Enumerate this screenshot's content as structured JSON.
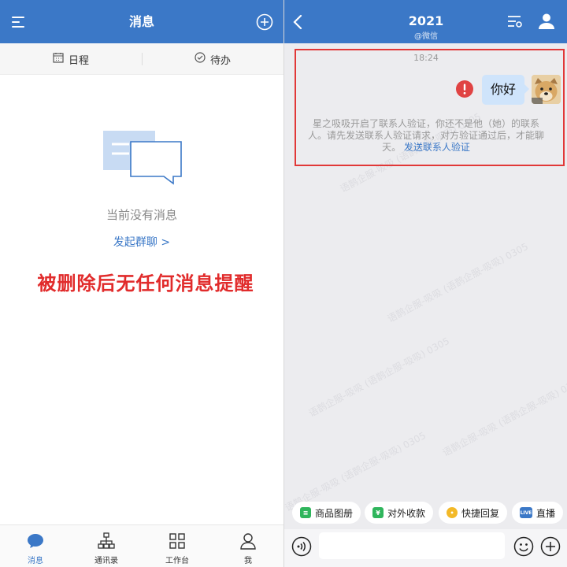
{
  "left": {
    "title": "消息",
    "icons": {
      "menu": "menu-icon",
      "add": "plus-circle-icon"
    },
    "subtabs": [
      {
        "label": "日程",
        "icon": "calendar-icon"
      },
      {
        "label": "待办",
        "icon": "check-circle-icon"
      }
    ],
    "empty_state": {
      "text": "当前没有消息",
      "link": "发起群聊 >"
    },
    "annotation": "被删除后无任何消息提醒",
    "tabbar": [
      {
        "label": "消息",
        "icon": "chat-bubble-icon",
        "active": true
      },
      {
        "label": "通讯录",
        "icon": "org-chart-icon",
        "active": false
      },
      {
        "label": "工作台",
        "icon": "grid-icon",
        "active": false
      },
      {
        "label": "我",
        "icon": "person-icon",
        "active": false
      }
    ]
  },
  "right": {
    "title": "2021",
    "subtitle": "@微信",
    "icons": {
      "back": "back-arrow-icon",
      "settings": "chat-settings-icon",
      "profile": "person-icon"
    },
    "timestamp": "18:24",
    "message": {
      "text": "你好",
      "status": "failed",
      "status_icon": "error-exclamation-icon"
    },
    "verify_note": {
      "text": "星之吸吸开启了联系人验证，你还不是他（她）的联系人。请先发送联系人验证请求，对方验证通过后，才能聊天。",
      "link": "发送联系人验证"
    },
    "watermark": "语鹊企服-吸吸 (语鹊企服-吸吸) 0305",
    "quick_actions": [
      {
        "label": "商品图册",
        "icon": "catalog-icon",
        "color": "#2fb55c"
      },
      {
        "label": "对外收款",
        "icon": "yen-icon",
        "color": "#2fb55c"
      },
      {
        "label": "快捷回复",
        "icon": "quick-reply-icon",
        "color": "#f3b928"
      },
      {
        "label": "直播",
        "icon": "live-icon",
        "color": "#3b78c7"
      }
    ],
    "input": {
      "placeholder": ""
    }
  },
  "colors": {
    "brand": "#3b78c7",
    "alert": "#e12b2b",
    "bubble": "#cfe4fb",
    "chat_bg": "#ececef"
  }
}
